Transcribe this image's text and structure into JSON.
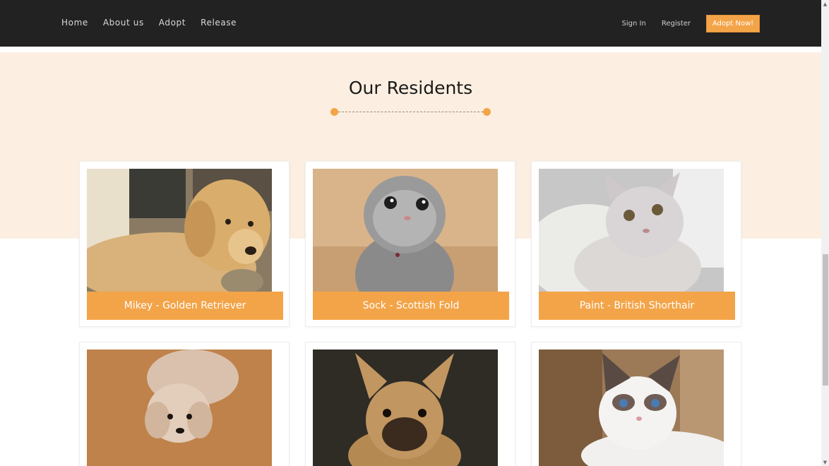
{
  "nav": {
    "links": [
      "Home",
      "About us",
      "Adopt",
      "Release"
    ],
    "sign_in": "Sign In",
    "register": "Register",
    "cta": "Adopt Now!"
  },
  "section": {
    "title": "Our Residents"
  },
  "residents": [
    {
      "caption": "Mikey - Golden Retriever",
      "icon": "golden-retriever-photo"
    },
    {
      "caption": "Sock - Scottish Fold",
      "icon": "scottish-fold-photo"
    },
    {
      "caption": "Paint - British Shorthair",
      "icon": "british-shorthair-photo"
    },
    {
      "caption": "",
      "icon": "poodle-photo"
    },
    {
      "caption": "",
      "icon": "french-bulldog-photo"
    },
    {
      "caption": "",
      "icon": "ragdoll-photo"
    }
  ],
  "colors": {
    "nav_bg": "#222222",
    "accent": "#f3a448",
    "section_bg": "#fcefe1"
  }
}
